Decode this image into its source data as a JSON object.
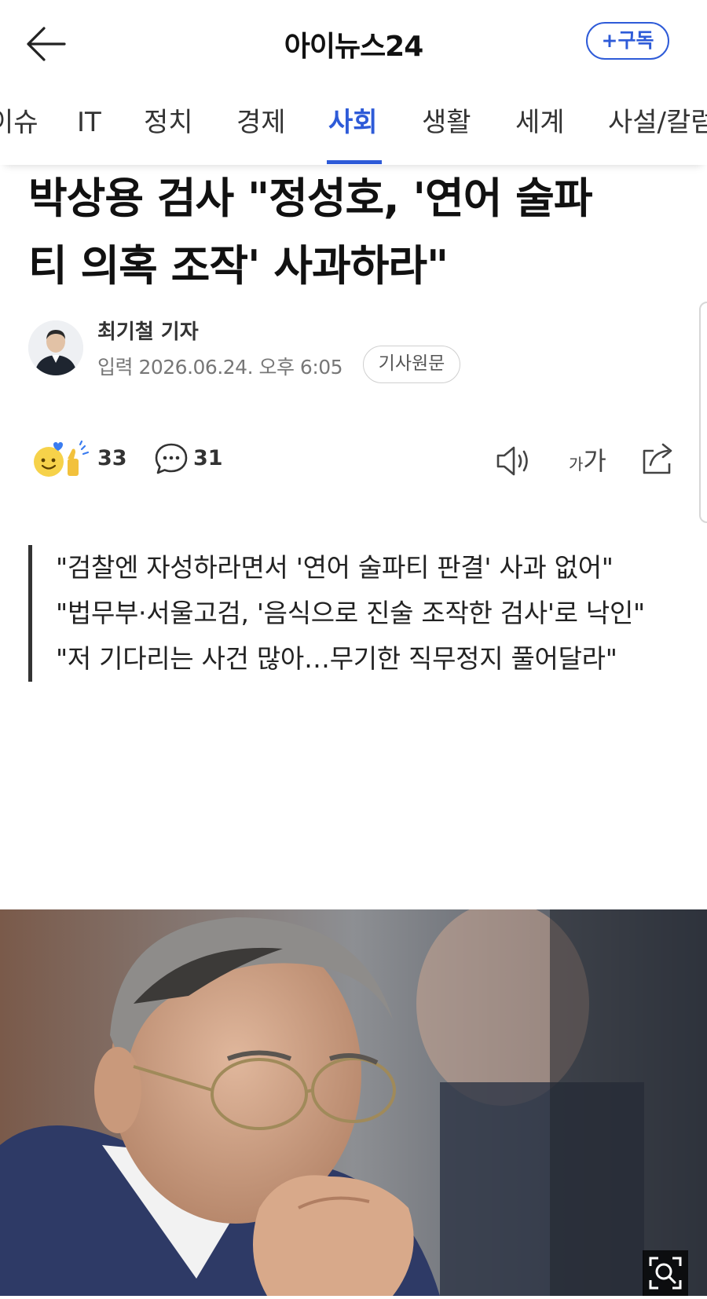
{
  "app": {
    "brand": "아이뉴스24",
    "subscribe_label": "+구독"
  },
  "tabs": [
    {
      "label": "이슈"
    },
    {
      "label": "IT"
    },
    {
      "label": "정치"
    },
    {
      "label": "경제"
    },
    {
      "label": "사회",
      "active": true
    },
    {
      "label": "생활"
    },
    {
      "label": "세계"
    },
    {
      "label": "사설/칼럼"
    }
  ],
  "article": {
    "headline_line1": "박상용 검사 \"정성호, '연어 술파",
    "headline_line2": "티 의혹 조작' 사과하라\"",
    "reporter": "최기철 기자",
    "published": "입력 2026.06.24. 오후 6:05",
    "source_button": "기사원문",
    "summary": [
      "\"검찰엔 자성하라면서 '연어 술파티 판결' 사과 없어\"",
      "\"법무부·서울고검, '음식으로 진술 조작한 검사'로 낙인\"",
      "\"저 기다리는 사건 많아…무기한 직무정지 풀어달라\""
    ]
  },
  "actions": {
    "reaction_count": "33",
    "comment_count": "31",
    "font_small": "가",
    "font_large": "가"
  },
  "colors": {
    "accent": "#2e5bd8",
    "text": "#111111",
    "muted": "#777777"
  },
  "icons": [
    "back-arrow-icon",
    "emoji-reaction-icon",
    "comment-bubble-icon",
    "speaker-icon",
    "share-icon",
    "zoom-icon"
  ]
}
